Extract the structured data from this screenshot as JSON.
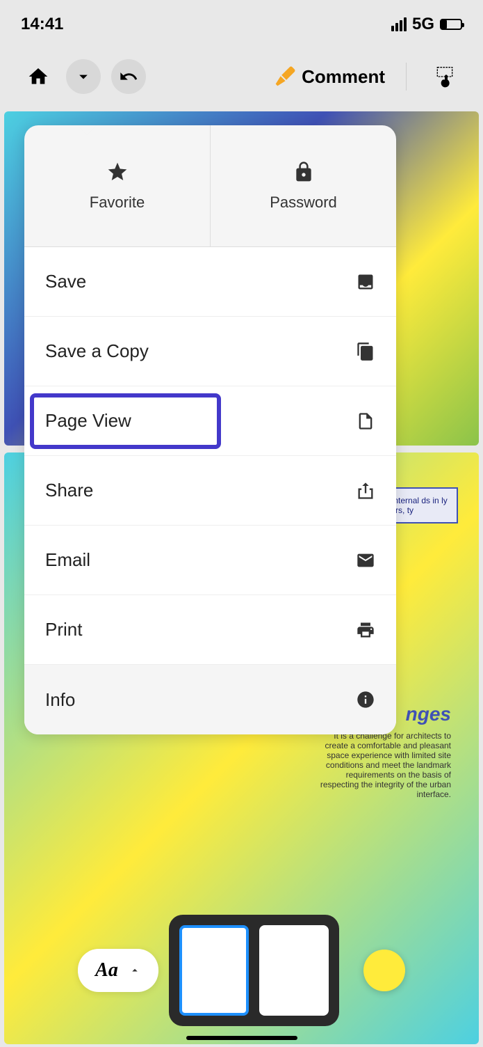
{
  "statusBar": {
    "time": "14:41",
    "network": "5G"
  },
  "toolbar": {
    "commentLabel": "Comment"
  },
  "dropdown": {
    "topRow": {
      "favorite": "Favorite",
      "password": "Password"
    },
    "items": [
      {
        "label": "Save",
        "icon": "inbox-icon"
      },
      {
        "label": "Save a Copy",
        "icon": "copy-icon"
      },
      {
        "label": "Page View",
        "icon": "page-icon",
        "highlighted": true
      },
      {
        "label": "Share",
        "icon": "share-icon"
      },
      {
        "label": "Email",
        "icon": "mail-icon"
      },
      {
        "label": "Print",
        "icon": "print-icon"
      },
      {
        "label": "Info",
        "icon": "info-icon"
      }
    ]
  },
  "document": {
    "textBoxSnippet": "oints of Internal ds in ly es, such rs, ty",
    "heading": "nges",
    "paragraph": "It is a challenge for architects to create a comfortable and pleasant space experience with limited site conditions and meet the landmark requirements on the basis of respecting the integrity of the urban interface."
  },
  "bottom": {
    "fontLabel": "Aa"
  }
}
